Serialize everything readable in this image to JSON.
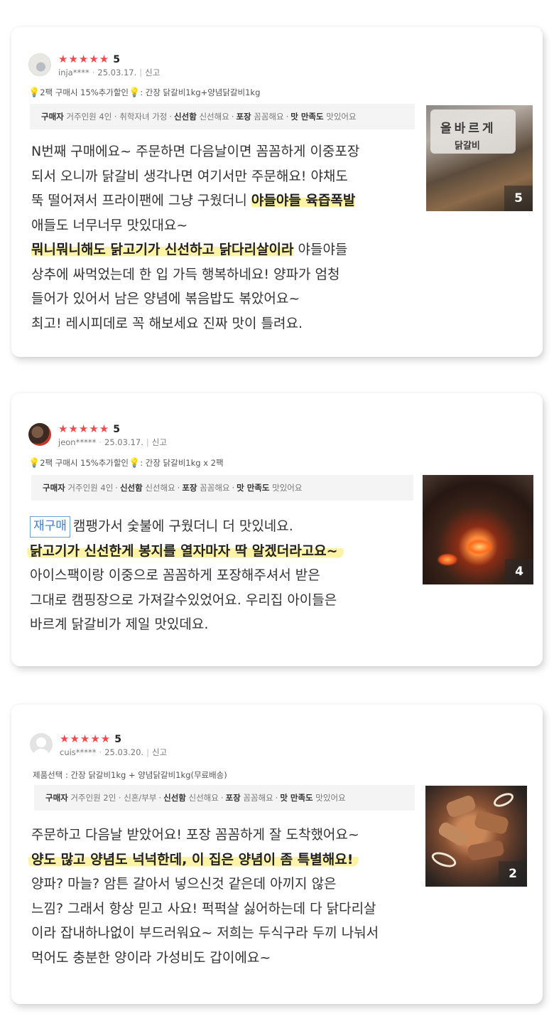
{
  "reviews": [
    {
      "rating_stars": "★★★★★",
      "rating": "5",
      "user": "inja****",
      "date": "25.03.17.",
      "report": "신고",
      "option": "2팩 구매시 15%추가할인",
      "option_product": ": 간장 닭갈비1kg+양념닭갈비1kg",
      "survey": {
        "buyer_label": "구매자",
        "buyer_value": "거주인원 4인 · 취학자녀 가정",
        "fresh_label": "신선함",
        "fresh_value": "신선해요",
        "pack_label": "포장",
        "pack_value": "꼼꼼해요",
        "taste_label": "맛 만족도",
        "taste_value": "맛있어요"
      },
      "photo_count": "5",
      "bag_title": "올바르게",
      "bag_sub": "닭갈비",
      "lines": {
        "l1": "N번째 구매에요~ 주문하면 다음날이면 꼼꼼하게 이중포장",
        "l2": "되서 오니까 닭갈비 생각나면 여기서만 주문해요! 야채도",
        "l3a": "뚝 떨어져서 프라이팬에 그냥 구웠더니 ",
        "l3b": "야들야들 육즙폭발",
        "l4": "애들도 너무너무 맛있대요~",
        "l5a": "뭐니뭐니해도 닭고기가 신선하고 닭다리살이라",
        "l5b": " 야들야들",
        "l6": "상추에 싸먹었는데 한 입 가득 행복하네요! 양파가 엄청",
        "l7": "들어가 있어서 남은 양념에 볶음밥도 볶았어요~",
        "l8": "최고! 레시피데로 꼭 해보세요 진짜 맛이 틀려요."
      }
    },
    {
      "rating_stars": "★★★★★",
      "rating": "5",
      "user": "jeon*****",
      "date": "25.03.17.",
      "report": "신고",
      "option": "2팩 구매시 15%추가할인",
      "option_product": ": 간장 닭갈비1kg x 2팩",
      "survey": {
        "buyer_label": "구매자",
        "buyer_value": "거주인원 4인",
        "fresh_label": "신선함",
        "fresh_value": "신선해요",
        "pack_label": "포장",
        "pack_value": "꼼꼼해요",
        "taste_label": "맛 만족도",
        "taste_value": "맛있어요"
      },
      "photo_count": "4",
      "tag": "재구매",
      "lines": {
        "l1": "캠팽가서 숯불에 구웠더니 더 맛있네요.",
        "l2": "닭고기가 신선한게 봉지를 열자마자 딱 알겠더라고요~",
        "l3": "아이스팩이랑 이중으로 꼼꼼하게 포장해주셔서 받은",
        "l4": "그대로 캠핑장으로 가져갈수있었어요. 우리집 아이들은",
        "l5": "바르계 닭갈비가 제일 맛있데요."
      }
    },
    {
      "rating_stars": "★★★★★",
      "rating": "5",
      "user": "cuis*****",
      "date": "25.03.20.",
      "report": "신고",
      "option": "제품선택 : 간장 닭갈비1kg + 양념닭갈비1kg(무료배송)",
      "survey": {
        "buyer_label": "구매자",
        "buyer_value": "거주인원 2인 · 신혼/부부",
        "fresh_label": "신선함",
        "fresh_value": "신선해요",
        "pack_label": "포장",
        "pack_value": "꼼꼼해요",
        "taste_label": "맛 만족도",
        "taste_value": "맛있어요"
      },
      "photo_count": "2",
      "lines": {
        "l1": "주문하고 다음날 받았어요! 포장 꼼꼼하게 잘 도착했어요~",
        "l2": "양도 많고 양념도 넉넉한데, 이 집은 양념이 좀 특별해요!",
        "l3": "양파? 마늘? 암튼 갈아서 넣으신것 같은데 아끼지 않은",
        "l4": "느낌? 그래서 항상 믿고 사요! 퍽퍽살 싫어하는데 다 닭다리살",
        "l5": "이라 잡내하나없이 부드러워요~ 저희는 두식구라 두끼 나눠서",
        "l6": "먹어도 충분한 양이라 가성비도 갑이에요~"
      }
    }
  ],
  "colors": {
    "star": "#f04b4b",
    "highlight": "#fdf3a6",
    "tag_border": "#6a9fd8",
    "survey_bg": "#f4f4f4"
  },
  "icons": {
    "bulb": "lightbulb-icon",
    "star": "star-icon",
    "avatar_default": "default-avatar-icon"
  }
}
